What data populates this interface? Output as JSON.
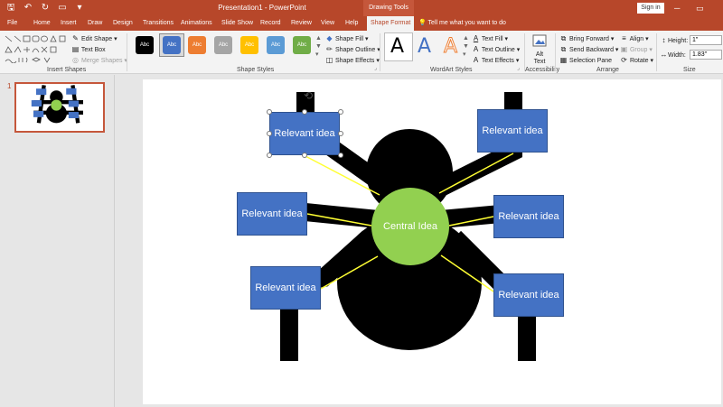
{
  "app": {
    "title": "Presentation1 - PowerPoint",
    "context_tab": "Drawing Tools",
    "signin": "Sign in"
  },
  "tabs": [
    "File",
    "Home",
    "Insert",
    "Draw",
    "Design",
    "Transitions",
    "Animations",
    "Slide Show",
    "Record",
    "Review",
    "View",
    "Help",
    "Shape Format"
  ],
  "tellme": "Tell me what you want to do",
  "ribbon": {
    "insert_shapes": {
      "label": "Insert Shapes",
      "edit_shape": "Edit Shape",
      "text_box": "Text Box",
      "merge_shapes": "Merge Shapes"
    },
    "shape_styles": {
      "label": "Shape Styles",
      "swatch_text": "Abc",
      "swatch_colors": [
        "#000000",
        "#4472c4",
        "#ed7d31",
        "#a5a5a5",
        "#ffc000",
        "#5b9bd5",
        "#70ad47"
      ],
      "shape_fill": "Shape Fill",
      "shape_outline": "Shape Outline",
      "shape_effects": "Shape Effects"
    },
    "wordart": {
      "label": "WordArt Styles",
      "glyph": "A",
      "text_fill": "Text Fill",
      "text_outline": "Text Outline",
      "text_effects": "Text Effects"
    },
    "accessibility": {
      "label": "Accessibility",
      "alt_text_1": "Alt",
      "alt_text_2": "Text"
    },
    "arrange": {
      "label": "Arrange",
      "bring_forward": "Bring Forward",
      "send_backward": "Send Backward",
      "selection_pane": "Selection Pane",
      "align": "Align",
      "group": "Group",
      "rotate": "Rotate"
    },
    "size": {
      "label": "Size",
      "height_label": "Height:",
      "height_value": "1\"",
      "width_label": "Width:",
      "width_value": "1.83\""
    }
  },
  "thumbnail": {
    "number": "1"
  },
  "slide": {
    "central_idea": "Central Idea",
    "ideas": [
      "Relevant idea",
      "Relevant idea",
      "Relevant idea",
      "Relevant idea",
      "Relevant idea",
      "Relevant idea"
    ]
  },
  "colors": {
    "accent": "#b7472a",
    "idea_fill": "#4472c4",
    "central_fill": "#92d050",
    "connector": "#ffff33"
  }
}
